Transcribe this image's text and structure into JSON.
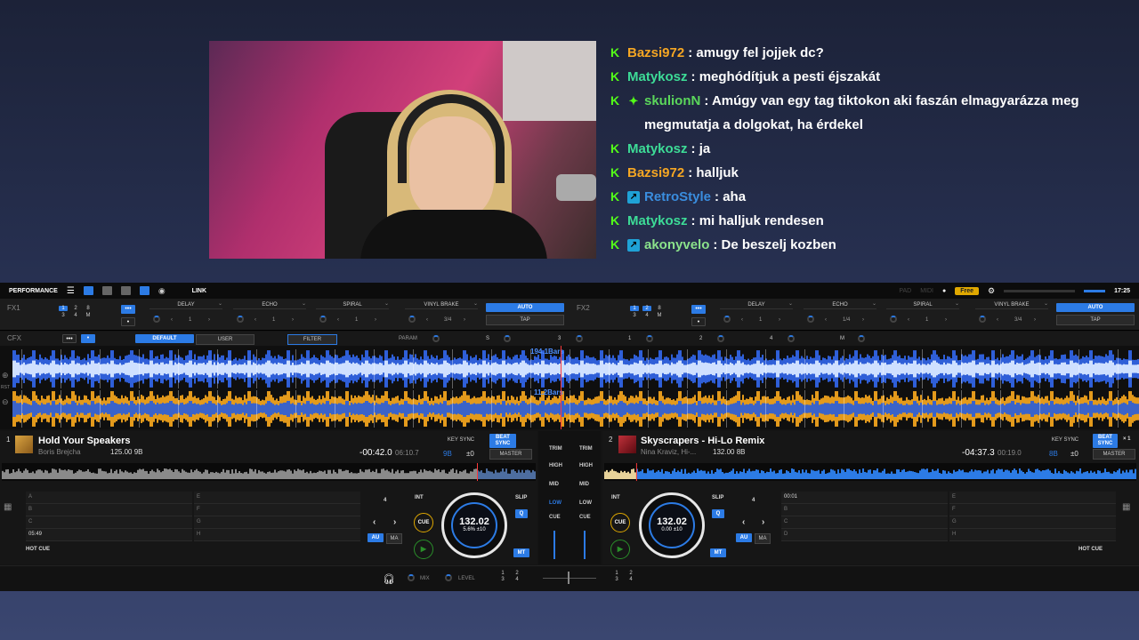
{
  "chat": [
    {
      "user": "Bazsi972",
      "color": "#f5a623",
      "badge2": null,
      "text": "amugy fel jojjek dc?"
    },
    {
      "user": "Matykosz",
      "color": "#3ddc97",
      "badge2": null,
      "text": "meghódítjuk a pesti éjszakát"
    },
    {
      "user": "skulionN",
      "color": "#5bd75b",
      "badge2": "green",
      "text": "Amúgy van egy tag tiktokon aki faszán elmagyarázza meg megmutatja a dolgokat, ha érdekel"
    },
    {
      "user": "Matykosz",
      "color": "#3ddc97",
      "badge2": null,
      "text": "ja"
    },
    {
      "user": "Bazsi972",
      "color": "#f5a623",
      "badge2": null,
      "text": "halljuk"
    },
    {
      "user": "RetroStyle",
      "color": "#3a8dde",
      "badge2": "blue",
      "text": "aha"
    },
    {
      "user": "Matykosz",
      "color": "#3ddc97",
      "badge2": null,
      "text": "mi halljuk rendesen"
    },
    {
      "user": "akonyvelo",
      "color": "#8be28b",
      "badge2": "blue",
      "text": "De beszelj kozben"
    }
  ],
  "topbar": {
    "mode": "PERFORMANCE",
    "link": "LINK",
    "pad": "PAD",
    "midi": "MIDI",
    "free": "Free",
    "time": "17:25"
  },
  "fx1": {
    "label": "FX1",
    "nums": [
      "1",
      "2",
      "8",
      "3",
      "4",
      "M"
    ],
    "effects": [
      "DELAY",
      "ECHO",
      "SPIRAL",
      "VINYL BRAKE"
    ],
    "values": [
      "1",
      "1",
      "1",
      "3/4"
    ],
    "auto": "AUTO",
    "tap": "TAP"
  },
  "fx2": {
    "label": "FX2",
    "nums": [
      "1",
      "2",
      "8",
      "3",
      "4",
      "M"
    ],
    "effects": [
      "DELAY",
      "ECHO",
      "SPIRAL",
      "VINYL BRAKE"
    ],
    "values": [
      "1",
      "1/4",
      "1",
      "3/4"
    ],
    "auto": "AUTO",
    "tap": "TAP"
  },
  "cfx": {
    "label": "CFX",
    "default": "DEFAULT",
    "user": "USER",
    "filter": "FILTER",
    "param": "PARAM",
    "slots": [
      "S",
      "3",
      "1",
      "2",
      "4",
      "M"
    ]
  },
  "waves": {
    "bars_top": "194.1Bars",
    "bars_bottom": "11.2Bars"
  },
  "deck1": {
    "num": "1",
    "title": "Hold Your Speakers",
    "artist": "Boris Brejcha",
    "bpm_key": "125.00  9B",
    "key_sync": "KEY SYNC",
    "beat_sync": "BEAT SYNC",
    "master": "MASTER",
    "time_remain": "-00:42.0",
    "time_total": "06:10.7",
    "key": "9B",
    "pitch": "±0",
    "hotcues_left": [
      "A",
      "B",
      "C",
      "05:49"
    ],
    "hotcues_right": [
      "E",
      "F",
      "G",
      "H"
    ],
    "hot_cue": "HOT CUE",
    "beats": "4",
    "int": "INT",
    "cue": "CUE",
    "slip": "SLIP",
    "q": "Q",
    "au": "AU",
    "ma": "MA",
    "mt": "MT",
    "jog_bpm": "132.02",
    "jog_sub": "5.6%  ±10"
  },
  "deck2": {
    "num": "2",
    "title": "Skyscrapers - Hi-Lo Remix",
    "artist": "Nina Kraviz, Hi-...",
    "bpm_key": "132.00  8B",
    "key_sync": "KEY SYNC",
    "beat_sync": "BEAT SYNC",
    "master": "MASTER",
    "x1": "× 1",
    "time_remain": "-04:37.3",
    "time_total": "00:19.0",
    "key": "8B",
    "pitch": "±0",
    "hotcues_left": [
      "00:01",
      "B",
      "C",
      "D"
    ],
    "hotcues_right": [
      "E",
      "F",
      "G",
      "H"
    ],
    "hot_cue": "HOT CUE",
    "beats": "4",
    "int": "INT",
    "cue": "CUE",
    "slip": "SLIP",
    "q": "Q",
    "au": "AU",
    "ma": "MA",
    "mt": "MT",
    "jog_bpm": "132.02",
    "jog_sub": "0.00  ±10"
  },
  "mixer": {
    "trim": "TRIM",
    "high": "HIGH",
    "mid": "MID",
    "low": "LOW",
    "cue": "CUE"
  },
  "bottom": {
    "mix": "MIX",
    "level": "LEVEL",
    "nums": [
      "1",
      "2",
      "3",
      "4"
    ]
  }
}
